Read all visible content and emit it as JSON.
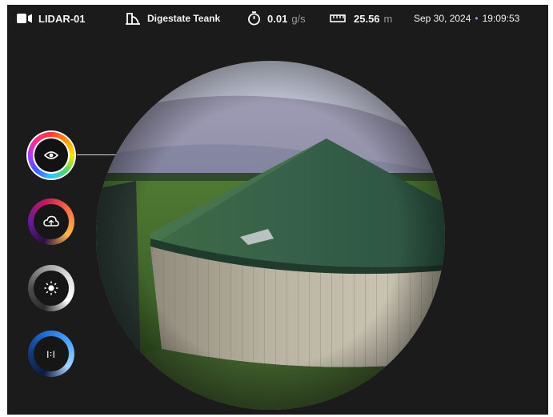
{
  "device": {
    "name": "LIDAR-01",
    "icon": "video-camera-icon"
  },
  "site": {
    "name": "Digestate Teank",
    "icon": "tank-icon"
  },
  "flow": {
    "value": "0.01",
    "unit": "g/s",
    "icon": "stopwatch-icon"
  },
  "distance": {
    "value": "25.56",
    "unit": "m",
    "icon": "ruler-icon"
  },
  "timestamp": {
    "date": "Sep 30, 2024",
    "separator": "•",
    "time": "19:09:53"
  },
  "modes": [
    {
      "name": "color-vision",
      "icon": "eye-icon",
      "active": true
    },
    {
      "name": "thermal",
      "icon": "cloud-sync-icon",
      "active": false
    },
    {
      "name": "brightness",
      "icon": "sun-icon",
      "active": false
    },
    {
      "name": "range",
      "icon": "range-icon",
      "label": "|:|",
      "active": false
    }
  ],
  "colors": {
    "background": "#1b1b1b",
    "text": "#f2f2f2",
    "muted": "#9a9a9a",
    "accent": "#8da3d6"
  }
}
